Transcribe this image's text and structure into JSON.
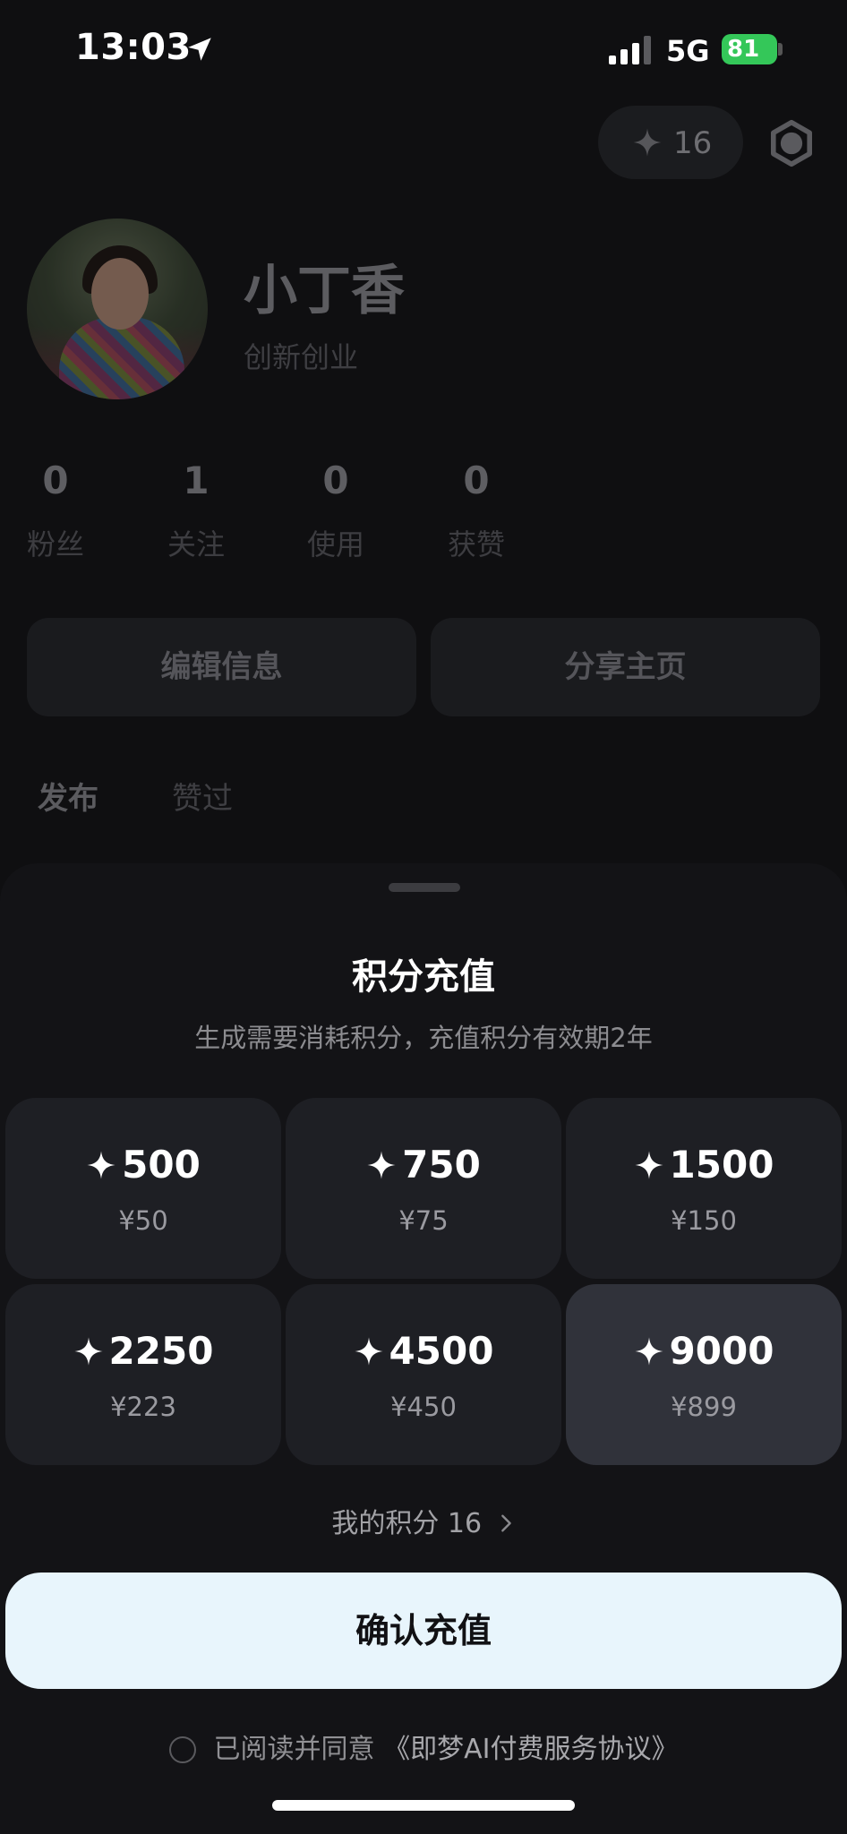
{
  "status_bar": {
    "time": "13:03",
    "network": "5G",
    "battery": "81"
  },
  "profile": {
    "points_badge": "16",
    "name": "小丁香",
    "bio": "创新创业",
    "stats": [
      {
        "value": "0",
        "label": "粉丝"
      },
      {
        "value": "1",
        "label": "关注"
      },
      {
        "value": "0",
        "label": "使用"
      },
      {
        "value": "0",
        "label": "获赞"
      }
    ],
    "edit_button": "编辑信息",
    "share_button": "分享主页",
    "tabs": [
      "发布",
      "赞过"
    ]
  },
  "sheet": {
    "title": "积分充值",
    "subtitle": "生成需要消耗积分，充值积分有效期2年",
    "packages": [
      {
        "points": "500",
        "price": "¥50"
      },
      {
        "points": "750",
        "price": "¥75"
      },
      {
        "points": "1500",
        "price": "¥150"
      },
      {
        "points": "2250",
        "price": "¥223"
      },
      {
        "points": "4500",
        "price": "¥450"
      },
      {
        "points": "9000",
        "price": "¥899"
      }
    ],
    "selected_index": 5,
    "my_points_label": "我的积分 16",
    "confirm_button": "确认充值",
    "agreement_prefix": "已阅读并同意",
    "agreement_link": "《即梦AI付费服务协议》"
  },
  "colors": {
    "accent_button": "#e8f5fc",
    "battery": "#34c759",
    "sheet_bg": "#131316",
    "selected_pack": "#30323a"
  }
}
